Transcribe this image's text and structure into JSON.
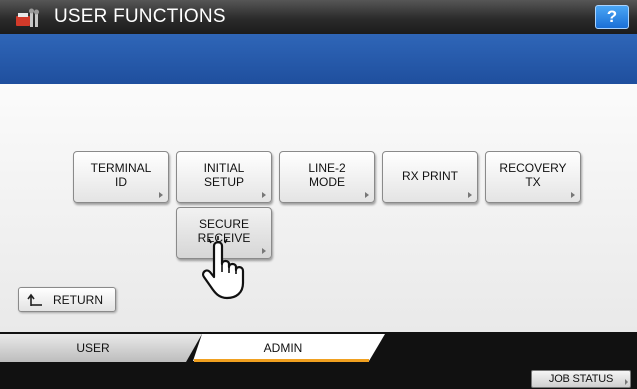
{
  "titlebar": {
    "icon": "user-functions-icon",
    "title": "USER FUNCTIONS",
    "help_label": "?"
  },
  "message": "",
  "buttons": {
    "terminal_id": "TERMINAL\nID",
    "initial_setup": "INITIAL\nSETUP",
    "line2_mode": "LINE-2\nMODE",
    "rx_print": "RX PRINT",
    "recovery_tx": "RECOVERY\nTX",
    "secure_receive": "SECURE\nRECEIVE"
  },
  "return_button": {
    "label": "RETURN",
    "icon": "return-arrow-icon"
  },
  "tabs": [
    {
      "label": "USER",
      "selected": false
    },
    {
      "label": "ADMIN",
      "selected": true
    }
  ],
  "job_status": "JOB STATUS",
  "colors": {
    "titlebar": "#2b2b2b",
    "message_band": "#2a5db0",
    "tab_accent": "#f0a020",
    "help_button": "#1a6fd6"
  }
}
